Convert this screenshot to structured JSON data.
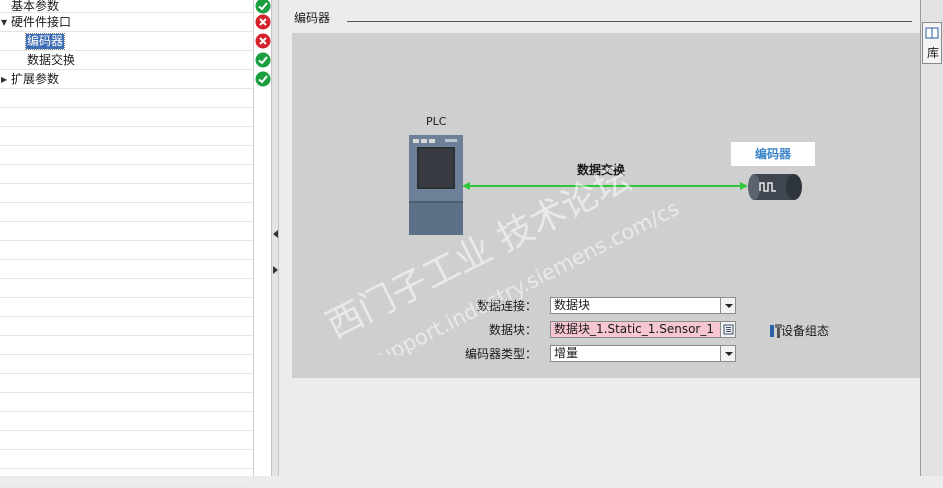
{
  "tree": {
    "items": [
      {
        "label": "基本参数",
        "expanded": null,
        "status": "ok"
      },
      {
        "label": "硬件件接口",
        "expanded": true,
        "status": "error"
      },
      {
        "label": "编码器",
        "expanded": null,
        "status": "error",
        "selected": true
      },
      {
        "label": "数据交换",
        "expanded": null,
        "status": "ok"
      },
      {
        "label": "扩展参数",
        "expanded": false,
        "status": "ok"
      }
    ]
  },
  "main": {
    "section_title": "编码器",
    "diagram": {
      "plc_label": "PLC",
      "encoder_label": "编码器",
      "link_label": "数据交换"
    },
    "fields": {
      "data_connection": {
        "label": "数据连接：",
        "value": "数据块"
      },
      "data_block": {
        "label": "数据块：",
        "value": "数据块_1.Static_1.Sensor_1"
      },
      "encoder_type": {
        "label": "编码器类型：",
        "value": "增量"
      }
    },
    "device_config": "设备组态"
  },
  "watermark": {
    "line1": "西门子工业 技术论坛",
    "line2": "support.industry.siemens.com/cs"
  },
  "right_strip": {
    "library_tab": "库"
  },
  "colors": {
    "ok": "#1a9e3f",
    "error": "#d6202a",
    "link": "#2ec73a",
    "selection": "#3d6db5",
    "encoder_label": "#3a86c8",
    "data_block_field": "#f6c6d2"
  }
}
